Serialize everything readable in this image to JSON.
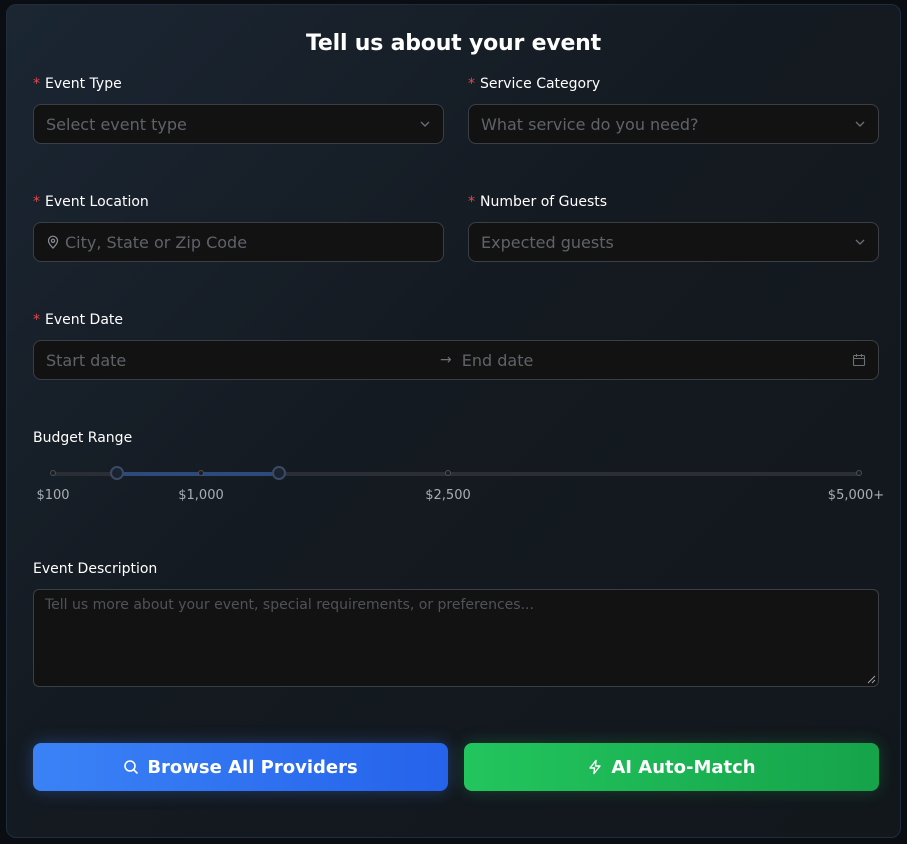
{
  "form": {
    "title": "Tell us about your event",
    "required_mark": "*",
    "event_type": {
      "label": "Event Type",
      "placeholder": "Select event type"
    },
    "service_category": {
      "label": "Service Category",
      "placeholder": "What service do you need?"
    },
    "event_location": {
      "label": "Event Location",
      "placeholder": "City, State or Zip Code"
    },
    "number_of_guests": {
      "label": "Number of Guests",
      "placeholder": "Expected guests"
    },
    "event_date": {
      "label": "Event Date",
      "start_placeholder": "Start date",
      "separator": "→",
      "end_placeholder": "End date"
    },
    "budget_range": {
      "label": "Budget Range",
      "min": 100,
      "max": 5000,
      "low_value_fraction": 0.08,
      "high_value_fraction": 0.28,
      "marks": [
        "$100",
        "$1,000",
        "$2,500",
        "$5,000+"
      ]
    },
    "event_description": {
      "label": "Event Description",
      "placeholder": "Tell us more about your event, special requirements, or preferences..."
    }
  },
  "actions": {
    "browse_label": "Browse All Providers",
    "auto_match_label": "AI Auto-Match"
  },
  "icons": {
    "select": "chevron-down-icon",
    "location": "map-pin-icon",
    "date": "calendar-icon",
    "browse": "search-icon",
    "auto_match": "lightning-icon"
  },
  "colors": {
    "required": "#e5484d",
    "primary": "#3b82f6",
    "success": "#22c55e"
  }
}
